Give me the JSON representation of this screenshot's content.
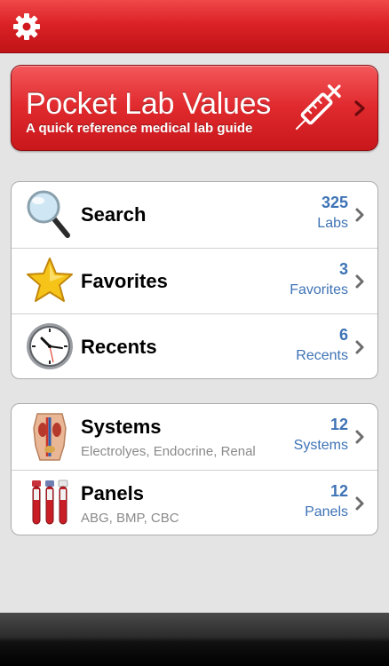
{
  "navbar": {
    "settings_icon": "gear-icon"
  },
  "banner": {
    "title": "Pocket Lab Values",
    "subtitle": "A quick reference medical lab guide",
    "icon": "syringe-icon"
  },
  "main_menu": [
    {
      "title": "Search",
      "count": "325",
      "unit": "Labs",
      "icon": "magnifier-icon"
    },
    {
      "title": "Favorites",
      "count": "3",
      "unit": "Favorites",
      "icon": "star-icon"
    },
    {
      "title": "Recents",
      "count": "6",
      "unit": "Recents",
      "icon": "clock-icon"
    }
  ],
  "category_menu": [
    {
      "title": "Systems",
      "subtitle": "Electrolyes, Endocrine, Renal",
      "count": "12",
      "unit": "Systems",
      "icon": "anatomy-icon"
    },
    {
      "title": "Panels",
      "subtitle": "ABG, BMP, CBC",
      "count": "12",
      "unit": "Panels",
      "icon": "blood-tubes-icon"
    }
  ],
  "colors": {
    "brand_red": "#db2226",
    "accent_blue": "#3e73b5",
    "subtitle_gray": "#8a8a8a"
  }
}
